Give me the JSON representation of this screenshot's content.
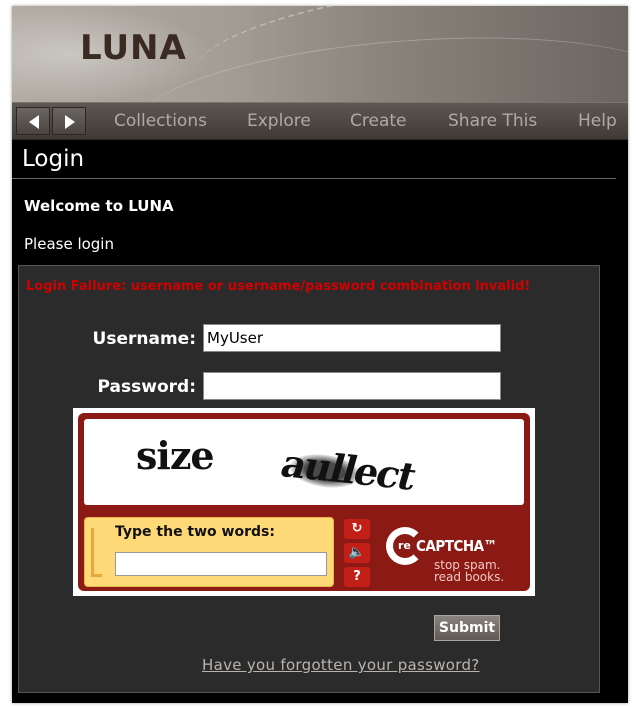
{
  "header": {
    "logo_text": "LUNA"
  },
  "nav": {
    "items": [
      "Collections",
      "Explore",
      "Create",
      "Share This",
      "Help"
    ]
  },
  "page": {
    "title": "Login",
    "welcome": "Welcome to LUNA",
    "prompt": "Please login"
  },
  "form": {
    "error": "Login Failure: username or username/password combination invalid!",
    "username_label": "Username:",
    "username_value": "MyUser",
    "password_label": "Password:",
    "password_value": "",
    "submit_label": "Submit",
    "forgot_link": "Have you forgotten your password?"
  },
  "captcha": {
    "word1": "size",
    "word2": "aullect",
    "instruction": "Type the two words:",
    "brand_prefix": "re",
    "brand_name": "CAPTCHA™",
    "tagline_1": "stop spam.",
    "tagline_2": "read books.",
    "button_icons": [
      "refresh-icon",
      "audio-icon",
      "help-icon"
    ]
  },
  "colors": {
    "error": "#d00000",
    "captcha_red": "#8b1a14",
    "captcha_yellow": "#ffd978"
  }
}
